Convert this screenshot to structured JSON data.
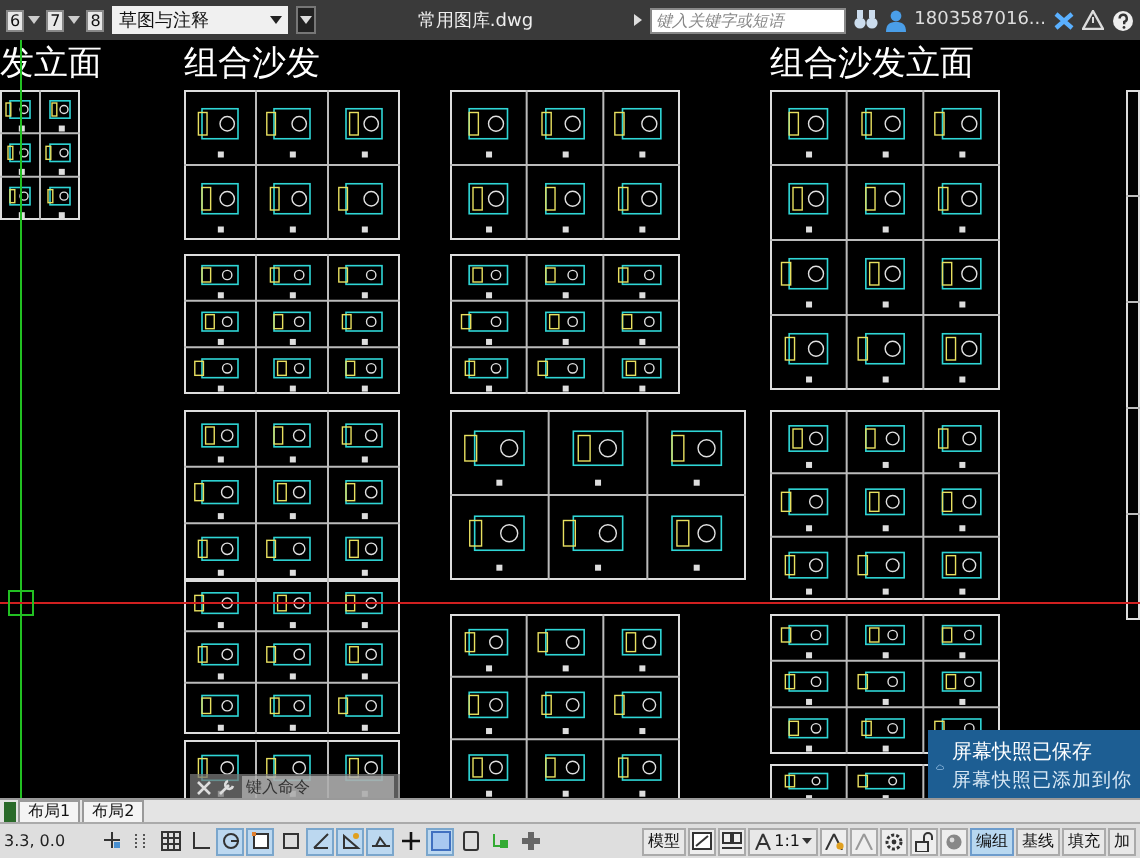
{
  "title_bar": {
    "quick_access_badges": [
      "6",
      "7",
      "8"
    ],
    "workspace": "草图与注释",
    "file_title": "常用图库.dwg",
    "search": {
      "placeholder": "键入关键字或短语"
    },
    "user": "1803587016..."
  },
  "drawing_area": {
    "headings": [
      {
        "text": "发立面"
      },
      {
        "text": "组合沙发"
      },
      {
        "text": "组合沙发立面"
      }
    ],
    "command_line": {
      "placeholder": "键入命令"
    }
  },
  "notification": {
    "title": "屏幕快照已保存",
    "message": "屏幕快照已添加到你"
  },
  "layout_tabs": [
    {
      "label": "布局1",
      "selected": false
    },
    {
      "label": "布局2",
      "selected": false
    }
  ],
  "status_bar": {
    "coordinates": "3.3, 0.0",
    "toggles": [
      {
        "on": false
      },
      {
        "on": false
      },
      {
        "on": false
      },
      {
        "on": false
      },
      {
        "on": true
      },
      {
        "on": true
      },
      {
        "on": false
      },
      {
        "on": true
      },
      {
        "on": true
      },
      {
        "on": true
      },
      {
        "on": false
      },
      {
        "on": true
      },
      {
        "on": false
      },
      {
        "on": false
      },
      {
        "on": false
      }
    ],
    "model": "模型",
    "scale": "1:1",
    "buttons": [
      {
        "label": "编组",
        "selected": true
      },
      {
        "label": "基线",
        "selected": false
      },
      {
        "label": "填充",
        "selected": false
      },
      {
        "label": "加",
        "selected": false
      }
    ]
  }
}
